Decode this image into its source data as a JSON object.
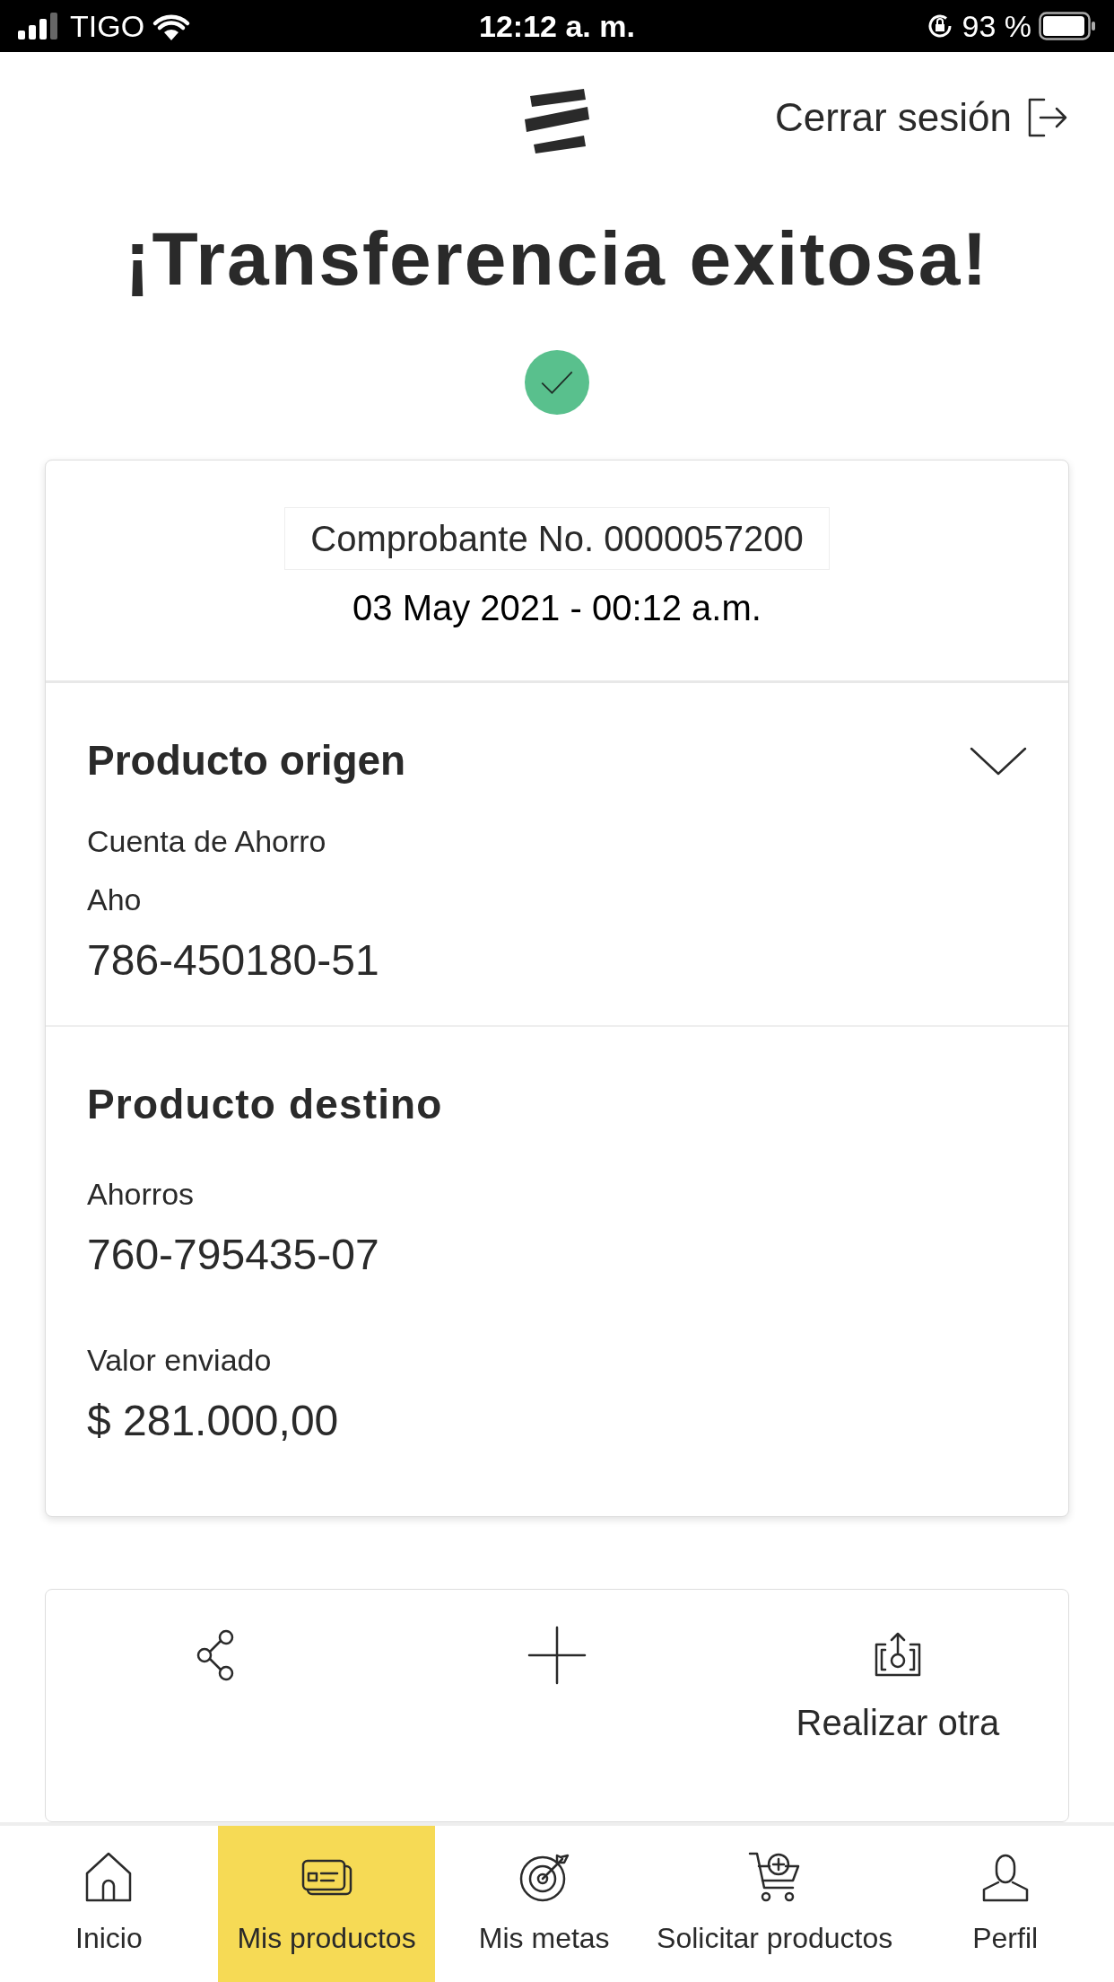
{
  "status_bar": {
    "carrier": "TIGO",
    "time": "12:12 a. m.",
    "battery": "93 %"
  },
  "header": {
    "logout": "Cerrar sesión"
  },
  "title": "¡Transferencia exitosa!",
  "receipt": {
    "number": "Comprobante No. 0000057200",
    "date": "03 May 2021 - 00:12 a.m."
  },
  "origin": {
    "title": "Producto origen",
    "expanded": false,
    "name": "Cuenta de Ahorro",
    "type": "Aho",
    "account": "786-450180-51"
  },
  "destination": {
    "title": "Producto destino",
    "type": "Ahorros",
    "account": "760-795435-07",
    "amount_label": "Valor enviado",
    "amount": "$ 281.000,00"
  },
  "actions": [
    {
      "kind": "share"
    },
    {
      "kind": "plus"
    },
    {
      "kind": "repeat",
      "label": "Realizar otra"
    }
  ],
  "nav": [
    {
      "kind": "home",
      "label": "Inicio",
      "selected": false
    },
    {
      "kind": "cards",
      "label": "Mis productos",
      "selected": true
    },
    {
      "kind": "target",
      "label": "Mis metas",
      "selected": false
    },
    {
      "kind": "cart",
      "label": "Solicitar productos",
      "selected": false
    },
    {
      "kind": "user",
      "label": "Perfil",
      "selected": false
    }
  ]
}
